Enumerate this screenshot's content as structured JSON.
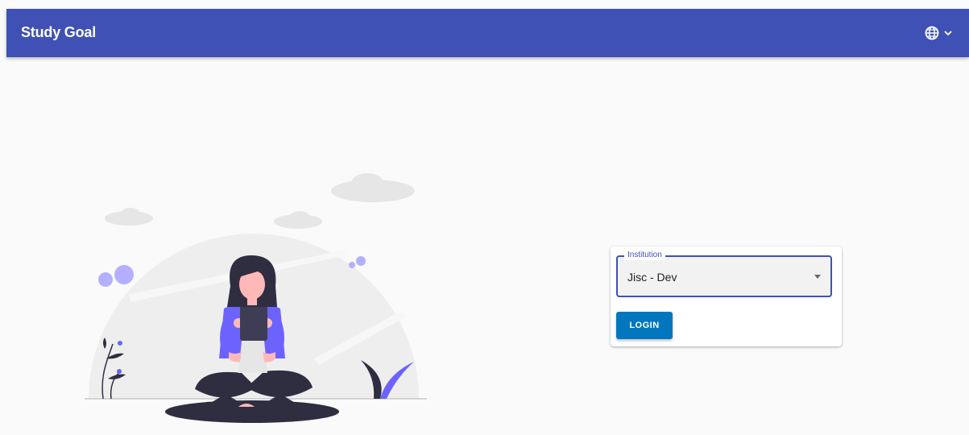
{
  "appbar": {
    "title": "Study Goal",
    "language_icon": "globe-icon",
    "language_chevron_icon": "chevron-down-icon",
    "color": "#3f51b5"
  },
  "illustration": {
    "description_icon": "person-reading-tablet-illustration",
    "accent_color": "#6c63ff",
    "dark_color": "#2f2e41"
  },
  "login": {
    "institution_label": "Institution",
    "institution_value": "Jisc - Dev",
    "button_label": "LOGIN",
    "button_color": "#0277bd"
  }
}
